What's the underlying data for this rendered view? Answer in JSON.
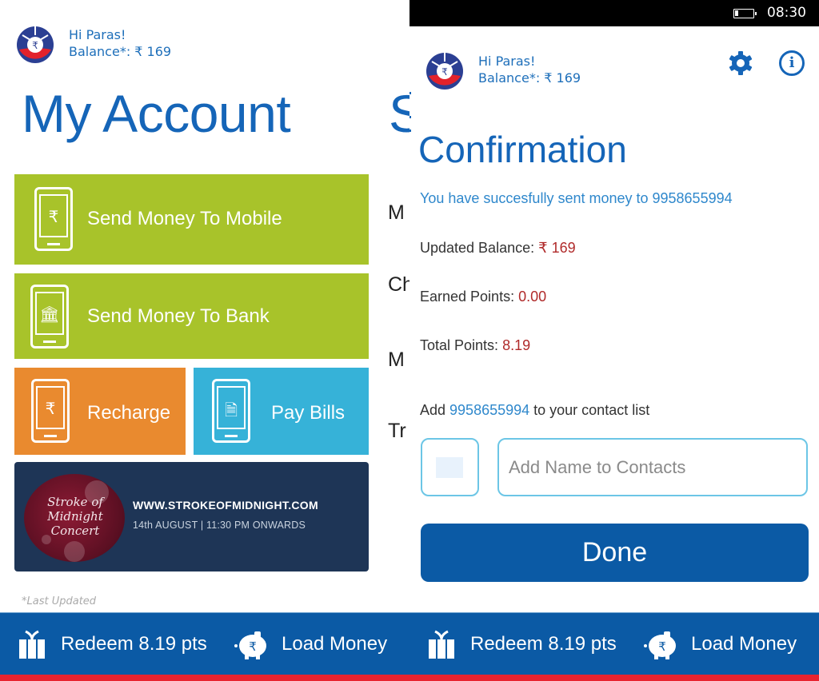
{
  "left": {
    "header": {
      "greeting": "Hi  Paras!",
      "balance": "Balance*: ₹ 169"
    },
    "pivot": {
      "title": "My Account",
      "next_title_peek": "S"
    },
    "tiles": [
      {
        "label": "Send Money To Mobile",
        "icon": "rupee-transfer-phone-icon",
        "color": "#a8c32a"
      },
      {
        "label": "Send Money To Bank",
        "icon": "bank-phone-icon",
        "color": "#a8c32a"
      },
      {
        "label": "Recharge",
        "icon": "battery-rupee-phone-icon",
        "color": "#e98a2f"
      },
      {
        "label": "Pay Bills",
        "icon": "bill-phone-icon",
        "color": "#36b2d8"
      }
    ],
    "banner": {
      "logo_text": "Stroke of Midnight Concert",
      "url": "WWW.STROKEOFMIDNIGHT.COM",
      "date": "14th AUGUST | 11:30 PM ONWARDS"
    },
    "next_pivot_peek_items": [
      "M",
      "Ch",
      "M",
      "Tr"
    ],
    "footnote": "*Last Updated",
    "appbar": {
      "redeem_label": "Redeem 8.19 pts",
      "load_label": "Load Money"
    }
  },
  "right": {
    "statusbar": {
      "time": "08:30",
      "battery_level": 0.2
    },
    "header": {
      "greeting": "Hi  Paras!",
      "balance": "Balance*: ₹ 169"
    },
    "title": "Confirmation",
    "success_message": "You have succesfully sent money to 9958655994",
    "details": [
      {
        "label": "Updated Balance: ",
        "value": "₹ 169"
      },
      {
        "label": "Earned Points: ",
        "value": "0.00"
      },
      {
        "label": "Total Points: ",
        "value": "8.19"
      }
    ],
    "add_contact": {
      "prefix": "Add ",
      "number": "9958655994",
      "suffix": " to your contact list",
      "placeholder": "Add Name to Contacts",
      "value": ""
    },
    "done_label": "Done",
    "appbar": {
      "redeem_label": "Redeem 8.19 pts",
      "load_label": "Load Money"
    }
  },
  "colors": {
    "brand_blue": "#0b5aa5",
    "title_blue": "#1565b8",
    "link_blue": "#2f88cc",
    "value_red": "#b02a2a",
    "accent_red": "#e8232f",
    "tile_green": "#a8c32a",
    "tile_orange": "#e98a2f",
    "tile_cyan": "#36b2d8",
    "banner_navy": "#1e3556"
  }
}
